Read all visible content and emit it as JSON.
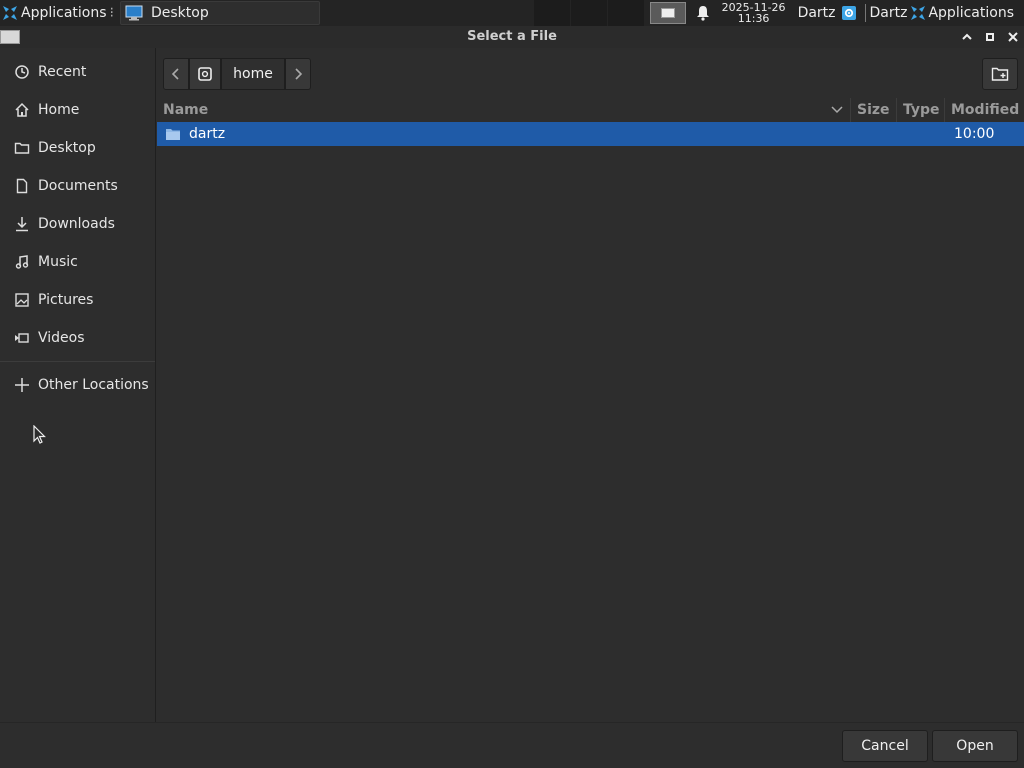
{
  "panel": {
    "applications_label": "Applications",
    "task_label": "Desktop",
    "clock_date": "2025-11-26",
    "clock_time": "11:36",
    "user_label": "Dartz",
    "user_label_2": "Dartz",
    "applications_label_2": "Applications",
    "icons": {
      "apps": "xfce-apps-icon",
      "task": "desktop-monitor-icon",
      "bell": "bell-icon",
      "settings": "gear-icon"
    }
  },
  "dialog": {
    "title": "Select a File",
    "sidebar": {
      "items": [
        {
          "label": "Recent",
          "icon": "clock-icon"
        },
        {
          "label": "Home",
          "icon": "home-icon"
        },
        {
          "label": "Desktop",
          "icon": "folder-icon"
        },
        {
          "label": "Documents",
          "icon": "document-icon"
        },
        {
          "label": "Downloads",
          "icon": "download-icon"
        },
        {
          "label": "Music",
          "icon": "music-icon"
        },
        {
          "label": "Pictures",
          "icon": "picture-icon"
        },
        {
          "label": "Videos",
          "icon": "video-icon"
        }
      ],
      "other_locations": "Other Locations"
    },
    "path": {
      "current": "home"
    },
    "columns": {
      "name": "Name",
      "size": "Size",
      "type": "Type",
      "modified": "Modified"
    },
    "files": [
      {
        "name": "dartz",
        "size": "",
        "type": "",
        "modified": "10:00",
        "selected": true
      }
    ],
    "buttons": {
      "cancel": "Cancel",
      "open": "Open"
    }
  },
  "colors": {
    "selection": "#1f5ba8",
    "background": "#2d2d2d",
    "panel": "#242424"
  }
}
